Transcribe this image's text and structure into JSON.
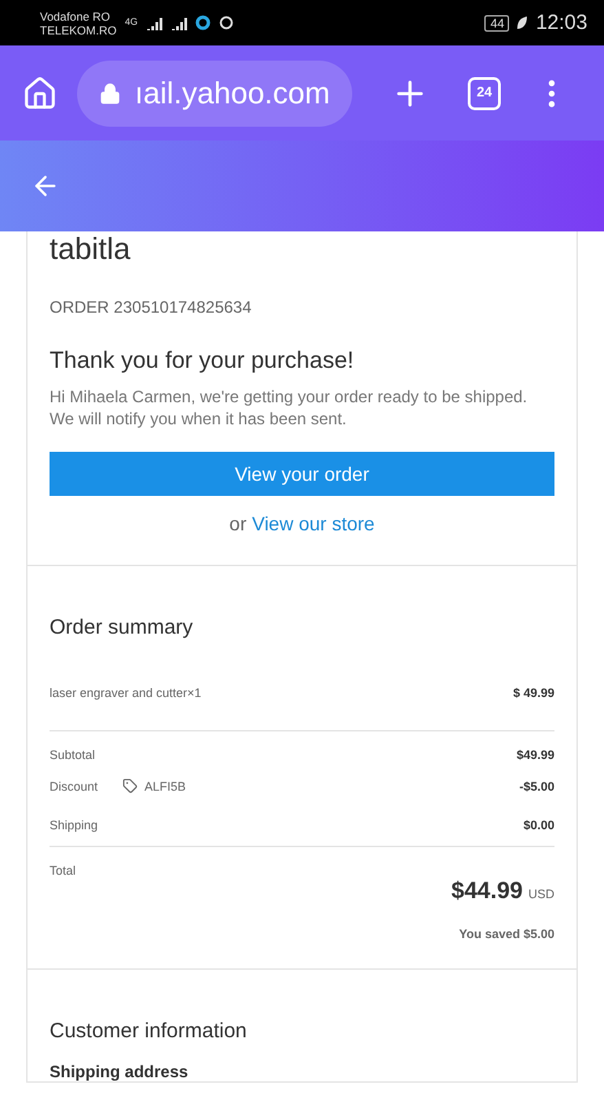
{
  "status_bar": {
    "carriers": [
      "Vodafone RO",
      "TELEKOM.RO"
    ],
    "network": "4G",
    "battery": "44",
    "time": "12:03"
  },
  "browser": {
    "url": "ıail.yahoo.com",
    "tab_count": "24"
  },
  "store": {
    "name": "tabitla",
    "order_number": "ORDER 230510174825634",
    "heading": "Thank you for your purchase!",
    "message": "Hi Mihaela Carmen, we're getting your order ready to be shipped. We will notify you when it has been sent.",
    "button": "View your order",
    "store_prefix": "or",
    "store_link": "View our store"
  },
  "summary": {
    "title": "Order summary",
    "items": [
      {
        "name": "laser engraver and cutter×1",
        "price": "$ 49.99"
      }
    ],
    "lines": [
      {
        "label": "Subtotal",
        "value": "$49.99"
      },
      {
        "label": "Discount",
        "code": "ALFI5B",
        "value": "-$5.00"
      },
      {
        "label": "Shipping",
        "value": "$0.00"
      }
    ],
    "total_label": "Total",
    "total": "$44.99",
    "currency": "USD",
    "saved": "You saved $5.00"
  },
  "customer": {
    "title": "Customer information",
    "shipping_title": "Shipping address"
  }
}
